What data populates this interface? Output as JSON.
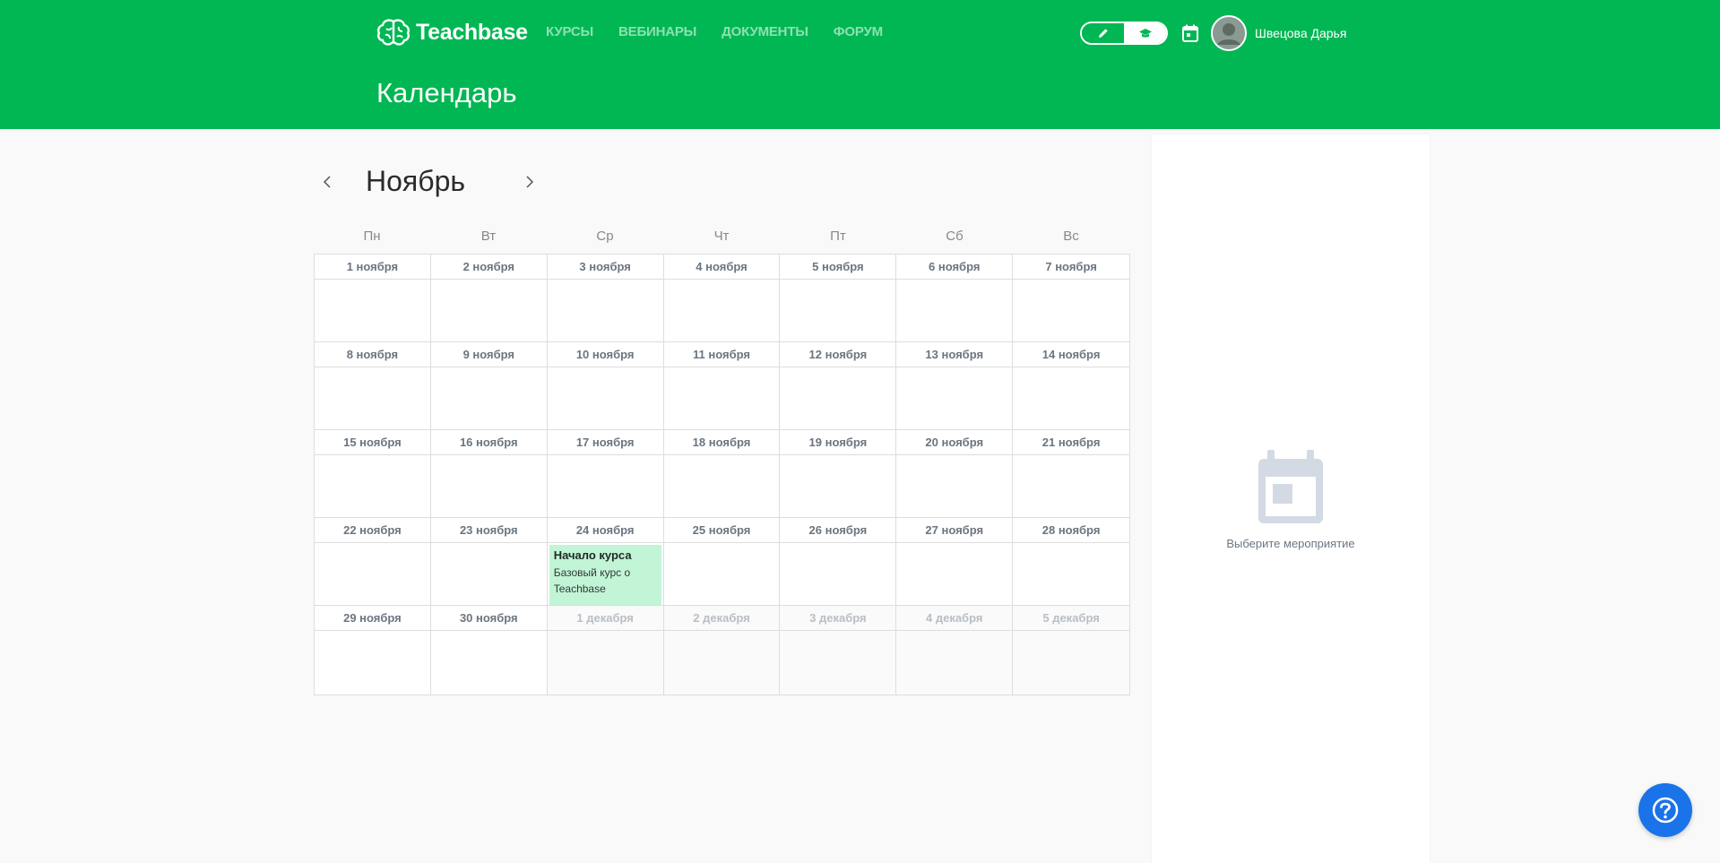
{
  "header": {
    "brand": "Teachbase",
    "nav": [
      "КУРСЫ",
      "ВЕБИНАРЫ",
      "ДОКУМЕНТЫ",
      "ФОРУМ"
    ],
    "page_title": "Календарь",
    "user_name": "Швецова Дарья"
  },
  "colors": {
    "brand_green": "#00b753",
    "event_bg": "#c2f4d6",
    "help_blue": "#1a73e8"
  },
  "calendar": {
    "month": "Ноябрь",
    "weekdays": [
      "Пн",
      "Вт",
      "Ср",
      "Чт",
      "Пт",
      "Сб",
      "Вс"
    ],
    "weeks": [
      [
        {
          "label": "1 ноября"
        },
        {
          "label": "2 ноября"
        },
        {
          "label": "3 ноября"
        },
        {
          "label": "4 ноября"
        },
        {
          "label": "5 ноября"
        },
        {
          "label": "6 ноября"
        },
        {
          "label": "7 ноября"
        }
      ],
      [
        {
          "label": "8 ноября"
        },
        {
          "label": "9 ноября"
        },
        {
          "label": "10 ноября"
        },
        {
          "label": "11 ноября"
        },
        {
          "label": "12 ноября"
        },
        {
          "label": "13 ноября"
        },
        {
          "label": "14 ноября"
        }
      ],
      [
        {
          "label": "15 ноября"
        },
        {
          "label": "16 ноября"
        },
        {
          "label": "17 ноября"
        },
        {
          "label": "18 ноября"
        },
        {
          "label": "19 ноября"
        },
        {
          "label": "20 ноября"
        },
        {
          "label": "21 ноября"
        }
      ],
      [
        {
          "label": "22 ноября"
        },
        {
          "label": "23 ноября"
        },
        {
          "label": "24 ноября",
          "event": {
            "title": "Начало курса",
            "desc": "Базовый курс о Teachbase"
          }
        },
        {
          "label": "25 ноября"
        },
        {
          "label": "26 ноября"
        },
        {
          "label": "27 ноября"
        },
        {
          "label": "28 ноября"
        }
      ],
      [
        {
          "label": "29 ноября"
        },
        {
          "label": "30 ноября"
        },
        {
          "label": "1 декабря",
          "other": true
        },
        {
          "label": "2 декабря",
          "other": true
        },
        {
          "label": "3 декабря",
          "other": true
        },
        {
          "label": "4 декабря",
          "other": true
        },
        {
          "label": "5 декабря",
          "other": true
        }
      ]
    ]
  },
  "side_panel": {
    "empty_text": "Выберите мероприятие"
  }
}
